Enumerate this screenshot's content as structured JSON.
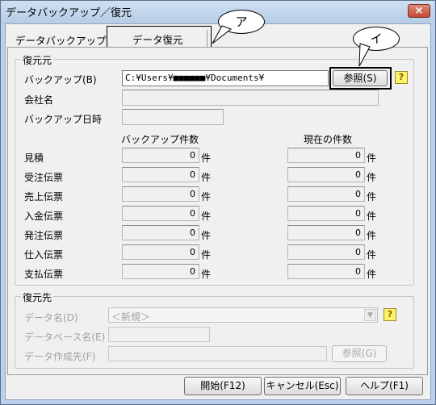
{
  "window": {
    "title": "データバックアップ／復元",
    "close_label": "×"
  },
  "tabs": {
    "backup_label": "データバックアップ",
    "restore_label": "データ復元"
  },
  "annotations": {
    "a": "ア",
    "i": "イ"
  },
  "source": {
    "group_title": "復元元",
    "backup_label": "バックアップ(B)",
    "backup_path": "C:¥Users¥■■■■■■¥Documents¥",
    "browse_label": "参照(S)",
    "help_label": "?",
    "company_label": "会社名",
    "company_value": "",
    "date_label": "バックアップ日時",
    "date_value": "",
    "col_backup": "バックアップ件数",
    "col_current": "現在の件数",
    "unit": "件",
    "rows": [
      {
        "label": "見積",
        "backup": "0",
        "current": "0"
      },
      {
        "label": "受注伝票",
        "backup": "0",
        "current": "0"
      },
      {
        "label": "売上伝票",
        "backup": "0",
        "current": "0"
      },
      {
        "label": "入金伝票",
        "backup": "0",
        "current": "0"
      },
      {
        "label": "発注伝票",
        "backup": "0",
        "current": "0"
      },
      {
        "label": "仕入伝票",
        "backup": "0",
        "current": "0"
      },
      {
        "label": "支払伝票",
        "backup": "0",
        "current": "0"
      }
    ]
  },
  "dest": {
    "group_title": "復元先",
    "name_label": "データ名(D)",
    "name_value": "＜新規＞",
    "help_label": "?",
    "db_label": "データベース名(E)",
    "db_value": "",
    "path_label": "データ作成先(F)",
    "path_value": "",
    "browse_label": "参照(G)"
  },
  "footer": {
    "start": "開始(F12)",
    "cancel": "キャンセル(Esc)",
    "help": "ヘルプ(F1)"
  }
}
